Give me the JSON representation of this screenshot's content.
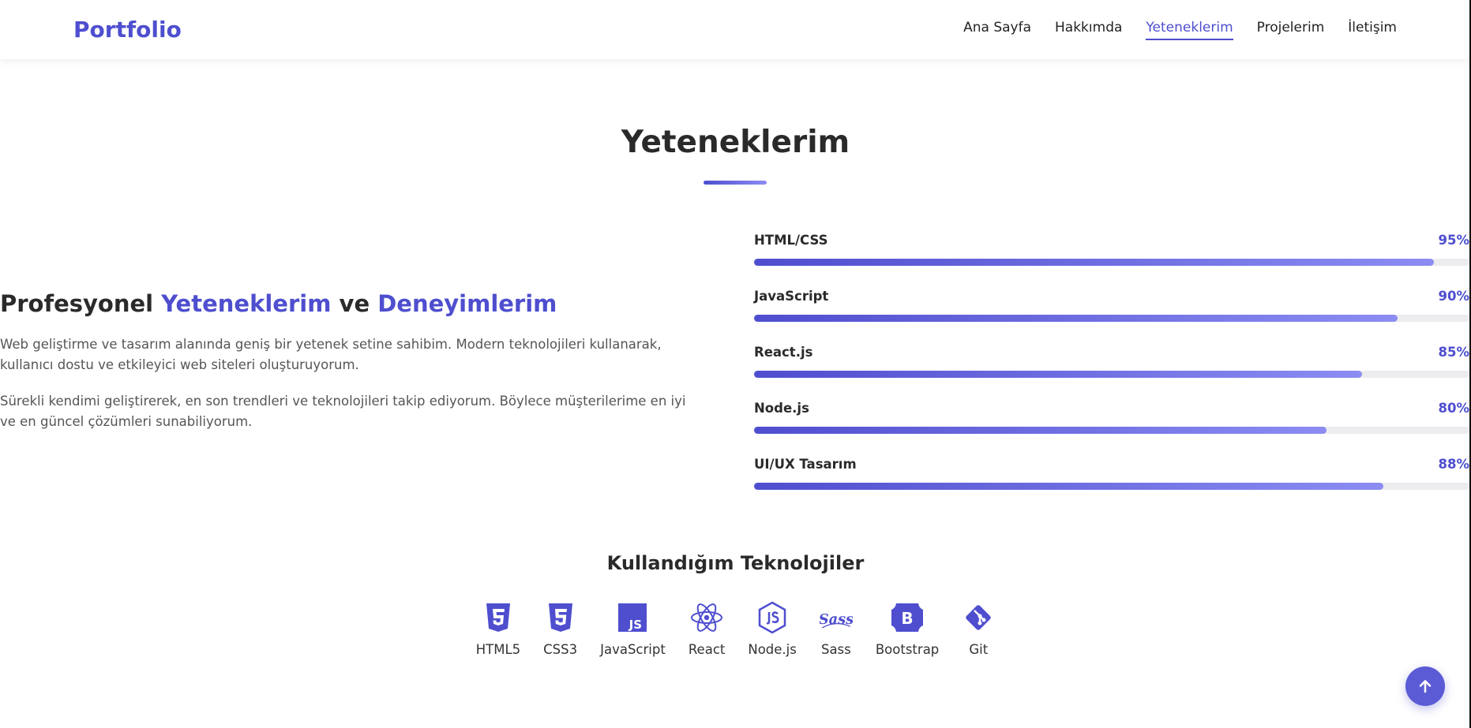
{
  "nav": {
    "brand": "Portfolio",
    "links": [
      {
        "label": "Ana Sayfa",
        "active": false
      },
      {
        "label": "Hakkımda",
        "active": false
      },
      {
        "label": "Yeteneklerim",
        "active": true
      },
      {
        "label": "Projelerim",
        "active": false
      },
      {
        "label": "İletişim",
        "active": false
      }
    ]
  },
  "section": {
    "title": "Yeteneklerim"
  },
  "intro": {
    "heading_parts": [
      "Profesyonel ",
      "Yeteneklerim",
      " ve ",
      "Deneyimlerim"
    ],
    "paragraphs": [
      "Web geliştirme ve tasarım alanında geniş bir yetenek setine sahibim. Modern teknolojileri kullanarak, kullanıcı dostu ve etkileyici web siteleri oluşturuyorum.",
      "Sürekli kendimi geliştirerek, en son trendleri ve teknolojileri takip ediyorum. Böylece müşterilerime en iyi ve en güncel çözümleri sunabiliyorum."
    ]
  },
  "skills": [
    {
      "name": "HTML/CSS",
      "percent_label": "95%",
      "percent": 95
    },
    {
      "name": "JavaScript",
      "percent_label": "90%",
      "percent": 90
    },
    {
      "name": "React.js",
      "percent_label": "85%",
      "percent": 85
    },
    {
      "name": "Node.js",
      "percent_label": "80%",
      "percent": 80
    },
    {
      "name": "UI/UX Tasarım",
      "percent_label": "88%",
      "percent": 88
    }
  ],
  "technologies": {
    "title": "Kullandığım Teknolojiler",
    "items": [
      {
        "label": "HTML5",
        "icon": "html5-icon"
      },
      {
        "label": "CSS3",
        "icon": "css3-icon"
      },
      {
        "label": "JavaScript",
        "icon": "javascript-icon"
      },
      {
        "label": "React",
        "icon": "react-icon"
      },
      {
        "label": "Node.js",
        "icon": "nodejs-icon"
      },
      {
        "label": "Sass",
        "icon": "sass-icon"
      },
      {
        "label": "Bootstrap",
        "icon": "bootstrap-icon"
      },
      {
        "label": "Git",
        "icon": "git-icon"
      }
    ],
    "icon_glyphs": {
      "javascript": "JS",
      "bootstrap": "B",
      "sass": "Sass"
    }
  },
  "colors": {
    "accent": "#4e4ecf",
    "accent_light": "#8c8cf3",
    "text": "#2a2a2a",
    "muted": "#555555"
  },
  "back_to_top": {
    "icon": "arrow-up-icon"
  }
}
